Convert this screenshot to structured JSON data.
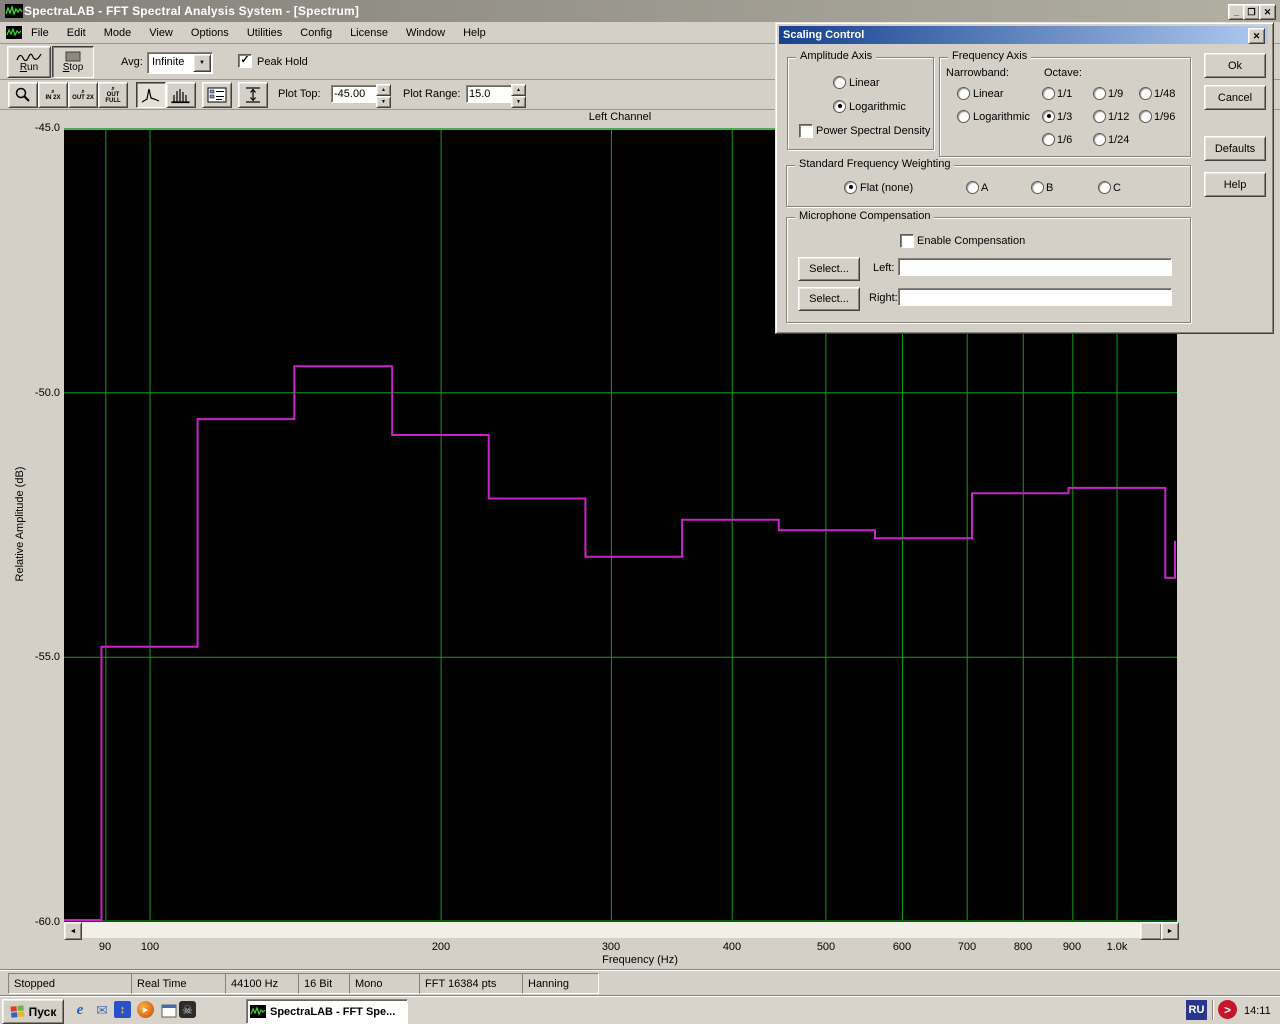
{
  "window": {
    "title": "SpectraLAB - FFT Spectral Analysis System - [Spectrum]"
  },
  "icons": {
    "minimize": "_",
    "maximize": "❐",
    "close": "✕",
    "dropdown": "▼",
    "spin_up": "▲",
    "spin_down": "▼",
    "scroll_left": "◄",
    "scroll_right": "►",
    "check": "✓",
    "tray_arrow": ">",
    "ie": "e",
    "mail": "✉",
    "updown": "↕",
    "play": "▶",
    "skull": "☠"
  },
  "menu": {
    "items": [
      "File",
      "Edit",
      "Mode",
      "View",
      "Options",
      "Utilities",
      "Config",
      "License",
      "Window",
      "Help"
    ]
  },
  "toolbar": {
    "run": "Run",
    "stop": "Stop",
    "avg_label": "Avg:",
    "avg_value": "Infinite",
    "peak_hold": "Peak Hold",
    "peak_hold_checked": true,
    "zoom_in_l1": "IN",
    "zoom_in_l2": "2X",
    "zoom_out_l1": "OUT",
    "zoom_out_l2": "2X",
    "zoom_full_l1": "OUT",
    "zoom_full_l2": "FULL",
    "plot_top_label": "Plot Top:",
    "plot_top_value": "-45.00",
    "plot_range_label": "Plot Range:",
    "plot_range_value": "15.0"
  },
  "dialog": {
    "title": "Scaling Control",
    "amplitude": {
      "legend": "Amplitude Axis",
      "linear": "Linear",
      "log": "Logarithmic",
      "selected": "Logarithmic",
      "psd": "Power Spectral Density",
      "psd_checked": false
    },
    "frequency": {
      "legend": "Frequency Axis",
      "narrowband": "Narrowband:",
      "octave": "Octave:",
      "linear": "Linear",
      "log": "Logarithmic",
      "octaves": [
        "1/1",
        "1/9",
        "1/48",
        "1/3",
        "1/12",
        "1/96",
        "1/6",
        "1/24"
      ],
      "octave_selected": "1/3"
    },
    "weighting": {
      "legend": "Standard Frequency Weighting",
      "options": [
        "Flat (none)",
        "A",
        "B",
        "C"
      ],
      "selected": "Flat (none)"
    },
    "mic": {
      "legend": "Microphone Compensation",
      "enable": "Enable Compensation",
      "enable_checked": false,
      "select": "Select...",
      "left": "Left:",
      "right": "Right:",
      "left_value": "",
      "right_value": ""
    },
    "ok": "Ok",
    "cancel": "Cancel",
    "defaults": "Defaults",
    "help": "Help"
  },
  "chart_data": {
    "type": "step-line",
    "description": "1/3-octave FFT spectrum with peak hold on log frequency axis",
    "title": "Left Channel",
    "xlabel": "Frequency (Hz)",
    "ylabel": "Relative Amplitude (dB)",
    "x_scale": "log",
    "x_tick_labels": [
      "90",
      "100",
      "200",
      "300",
      "400",
      "500",
      "600",
      "700",
      "800",
      "900",
      "1.0k"
    ],
    "x_gridlines_hz": [
      90,
      100,
      200,
      300,
      400,
      500,
      600,
      700,
      800,
      900,
      1000
    ],
    "x_range_hz": [
      81.5,
      1150
    ],
    "y_tick_labels": [
      "-45.0",
      "-50.0",
      "-55.0",
      "-60.0"
    ],
    "y_gridlines_db": [
      -50,
      -55
    ],
    "ylim": [
      -60,
      -45
    ],
    "bands": [
      {
        "from_hz": 89.1,
        "to_hz": 112,
        "db": -54.8
      },
      {
        "from_hz": 112,
        "to_hz": 141,
        "db": -50.5
      },
      {
        "from_hz": 141,
        "to_hz": 178,
        "db": -49.5
      },
      {
        "from_hz": 178,
        "to_hz": 224,
        "db": -50.8
      },
      {
        "from_hz": 224,
        "to_hz": 282,
        "db": -52.0
      },
      {
        "from_hz": 282,
        "to_hz": 355,
        "db": -53.1
      },
      {
        "from_hz": 355,
        "to_hz": 447,
        "db": -52.4
      },
      {
        "from_hz": 447,
        "to_hz": 562,
        "db": -52.6
      },
      {
        "from_hz": 562,
        "to_hz": 708,
        "db": -52.75
      },
      {
        "from_hz": 708,
        "to_hz": 891,
        "db": -51.9
      },
      {
        "from_hz": 891,
        "to_hz": 1122,
        "db": -51.8
      },
      {
        "from_hz": 1122,
        "to_hz": 1413,
        "db": -53.5
      }
    ],
    "right_edge_end_db": -52.8,
    "line_color": "#cc22cc",
    "grid_color": "#0fa00f",
    "plot_bg": "#000000"
  },
  "statusbar": {
    "panels": [
      "Stopped",
      "Real Time",
      "44100 Hz",
      "16 Bit",
      "Mono",
      "FFT 16384 pts",
      "Hanning"
    ]
  },
  "taskbar": {
    "start": "Пуск",
    "task": "SpectraLAB - FFT Spe...",
    "lang": "RU",
    "time": "14:11"
  }
}
